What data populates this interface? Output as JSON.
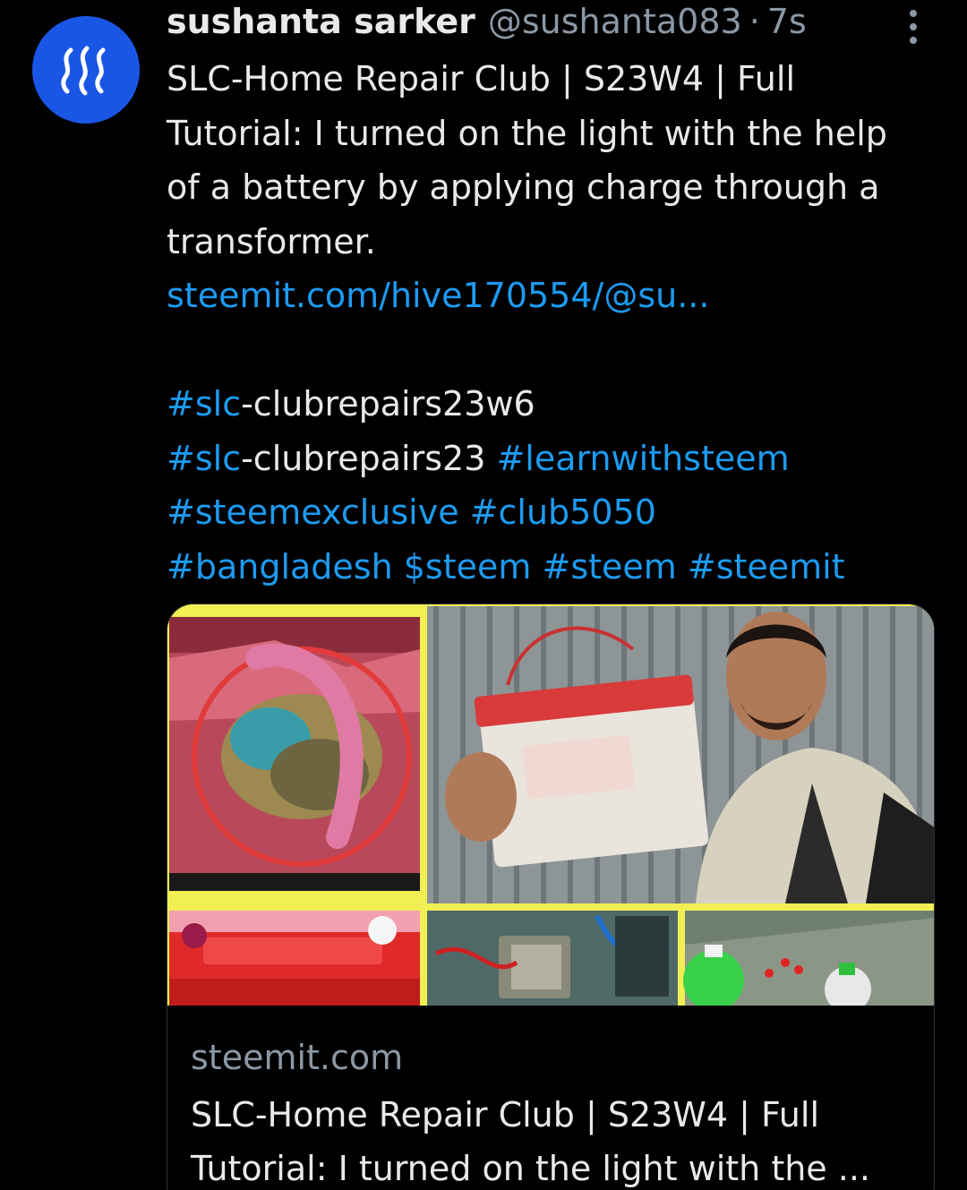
{
  "tweet": {
    "display_name": "sushanta sarker",
    "handle": "@sushanta083",
    "separator": "·",
    "time": "7s",
    "text_lines": [
      "SLC-Home Repair Club | S23W4 | Full",
      "Tutorial: I turned on the light with the help",
      "of a battery by applying charge through a",
      "transformer."
    ],
    "link": "steemit.com/hive170554/@su...",
    "hashtag_lines": [
      [
        {
          "t": "#slc",
          "link": true
        },
        {
          "t": "-clubrepairs23w6",
          "link": false
        }
      ],
      [
        {
          "t": "#slc",
          "link": true
        },
        {
          "t": "-clubrepairs23 ",
          "link": false
        },
        {
          "t": "#learnwithsteem",
          "link": true
        }
      ],
      [
        {
          "t": "#steemexclusive #club5050",
          "link": true
        }
      ],
      [
        {
          "t": "#bangladesh $steem #steem #steemit",
          "link": true
        }
      ]
    ]
  },
  "avatar": {
    "icon": "steem-logo-icon",
    "color": "#1a56e6"
  },
  "card": {
    "domain": "steemit.com",
    "title_lines": [
      "SLC-Home Repair Club | S23W4 | Full",
      "Tutorial: I turned on the light with the ..."
    ]
  },
  "colors": {
    "background": "#000000",
    "text": "#e7e9ea",
    "muted": "#8b98a5",
    "link": "#1d9bf0",
    "collage_border": "#f2ef55"
  }
}
